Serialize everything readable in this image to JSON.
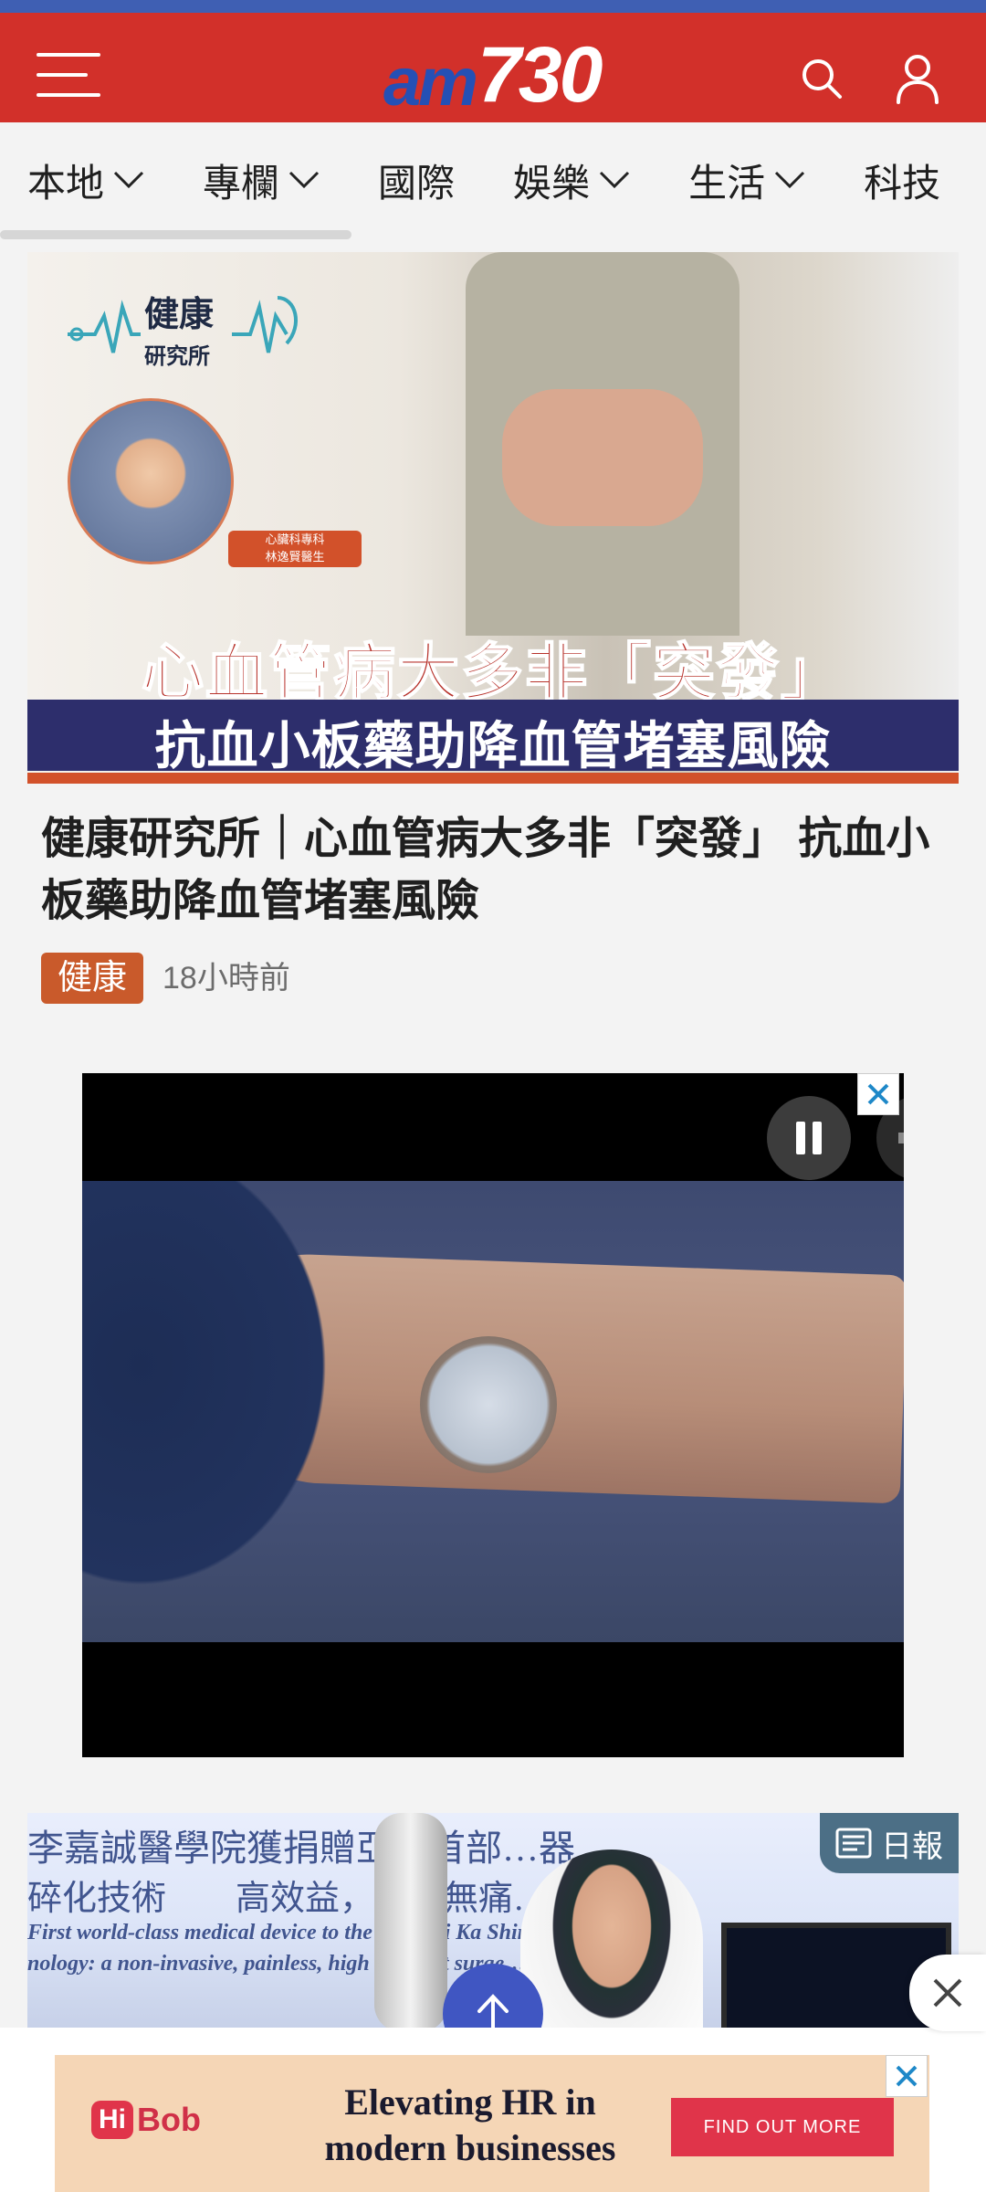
{
  "header": {
    "logo_prefix": "am",
    "logo_number": "730",
    "colors": {
      "header_bg": "#d2302a",
      "top_strip": "#3f5fb3",
      "logo_am": "#2550b5"
    },
    "icons": [
      "menu-icon",
      "search-icon",
      "user-icon"
    ]
  },
  "categories": [
    {
      "label": "本地",
      "has_dropdown": true
    },
    {
      "label": "專欄",
      "has_dropdown": true
    },
    {
      "label": "國際",
      "has_dropdown": false
    },
    {
      "label": "娛樂",
      "has_dropdown": true
    },
    {
      "label": "生活",
      "has_dropdown": true
    },
    {
      "label": "科技",
      "has_dropdown": false
    }
  ],
  "hero_image": {
    "brand_title": "健康",
    "brand_subtitle": "研究所",
    "doctor_tag_line1": "心臟科專科",
    "doctor_tag_line2": "林逸賢醫生",
    "headline_line1": "心血管病大多非「突發」",
    "headline_line2": "抗血小板藥助降血管堵塞風險"
  },
  "article": {
    "title": "健康研究所｜心血管病大多非「突發」 抗血小板藥助降血管堵塞風險",
    "category": "健康",
    "time": "18小時前",
    "category_color": "#c95a2b"
  },
  "video_ad": {
    "icons": [
      "pause-icon",
      "mute-icon",
      "close-icon"
    ]
  },
  "second_article": {
    "image_text_line1": "李嘉誠醫學院獲捐贈亞洲首部…器",
    "image_text_line2": "碎化技術　　高效益，無…無痛…法",
    "image_text_line3": "First world-class medical device to the HKU Li Ka Shing…ine",
    "image_text_line4": "nology: a non-invasive, painless, high efficient surge…",
    "source_badge": "日報"
  },
  "bottom_ad": {
    "brand_hi": "Hi",
    "brand_bob": "Bob",
    "headline_line1": "Elevating HR in",
    "headline_line2": "modern businesses",
    "cta": "FIND OUT MORE"
  }
}
